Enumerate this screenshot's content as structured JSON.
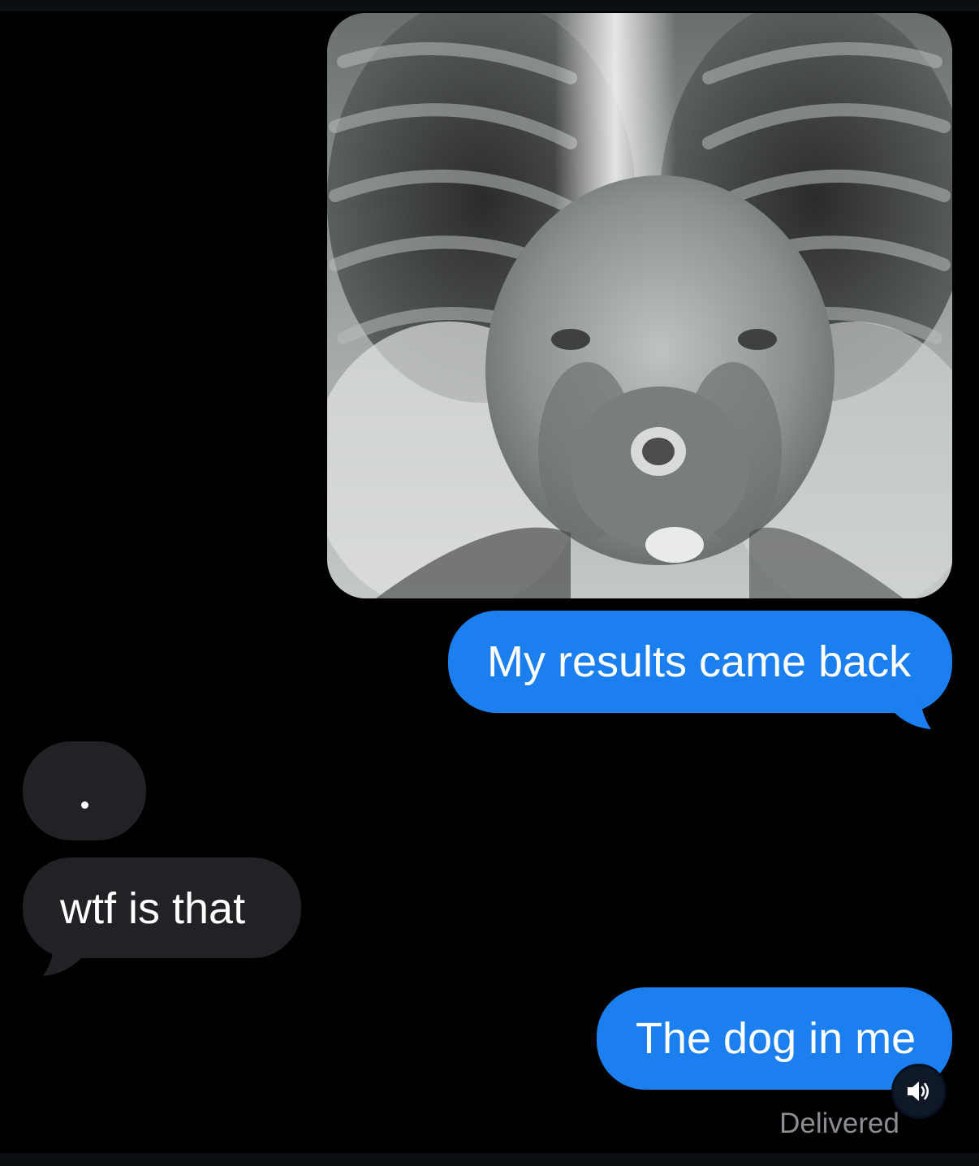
{
  "conversation": {
    "messages": [
      {
        "direction": "outgoing",
        "type": "image",
        "subject": "chest X-ray with a dog's face superimposed"
      },
      {
        "direction": "outgoing",
        "type": "text",
        "text": "My results came back"
      },
      {
        "direction": "incoming",
        "type": "text",
        "text": "."
      },
      {
        "direction": "incoming",
        "type": "text",
        "text": "wtf is that"
      },
      {
        "direction": "outgoing",
        "type": "text",
        "text": "The dog in me"
      }
    ],
    "status": "Delivered"
  },
  "colors": {
    "background": "#000000",
    "outgoing_bubble": "#1b7ff0",
    "incoming_bubble": "#202226",
    "status_text": "#8a8d92"
  },
  "icons": {
    "speaker": "speaker-icon"
  }
}
